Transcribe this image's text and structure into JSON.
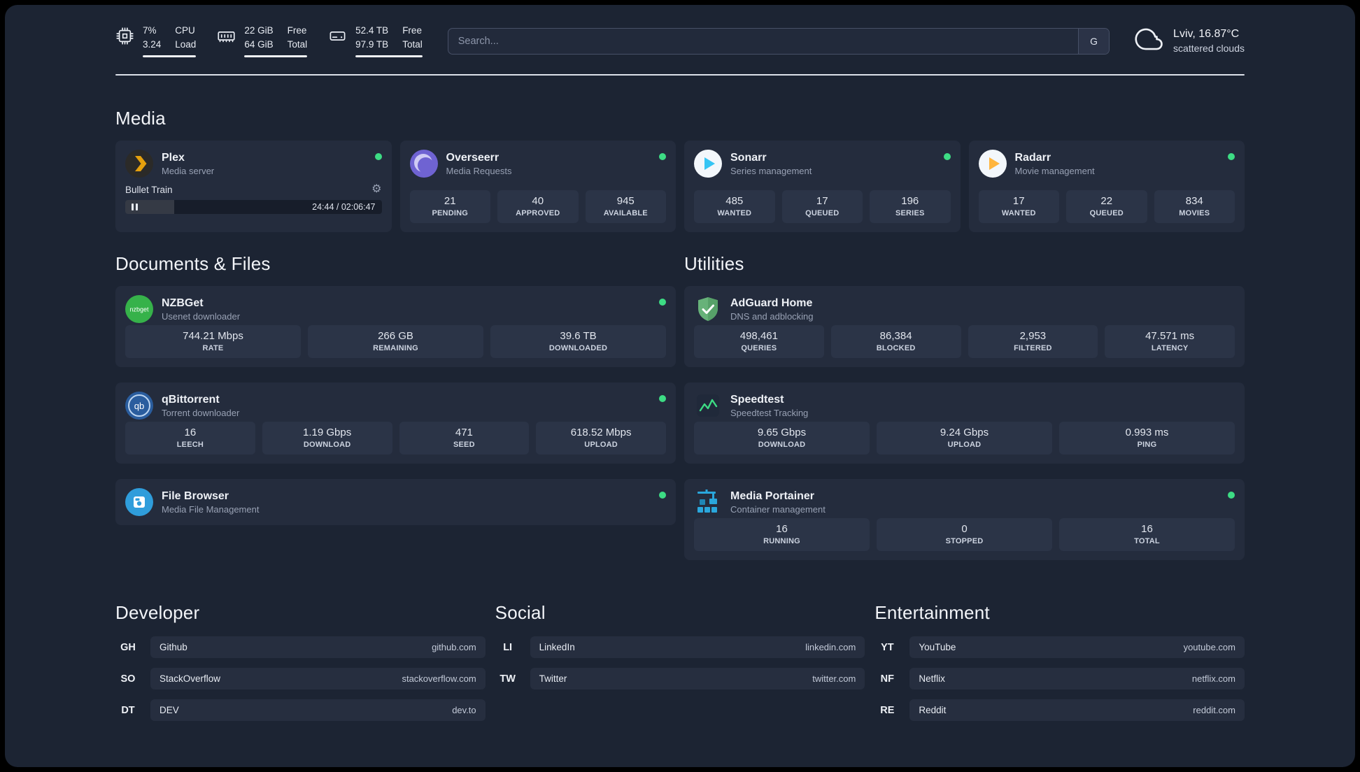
{
  "topbar": {
    "cpu": {
      "v1": "7%",
      "v2": "3.24",
      "l1": "CPU",
      "l2": "Load"
    },
    "ram": {
      "v1": "22 GiB",
      "v2": "64 GiB",
      "l1": "Free",
      "l2": "Total"
    },
    "disk": {
      "v1": "52.4 TB",
      "v2": "97.9 TB",
      "l1": "Free",
      "l2": "Total"
    },
    "search": {
      "placeholder": "Search...",
      "button": "G"
    },
    "weather": {
      "location": "Lviv, 16.87°C",
      "condition": "scattered clouds"
    }
  },
  "media": {
    "heading": "Media",
    "plex": {
      "name": "Plex",
      "desc": "Media server",
      "track": "Bullet Train",
      "time": "24:44 / 02:06:47"
    },
    "overseerr": {
      "name": "Overseerr",
      "desc": "Media Requests",
      "stats": [
        {
          "value": "21",
          "label": "PENDING"
        },
        {
          "value": "40",
          "label": "APPROVED"
        },
        {
          "value": "945",
          "label": "AVAILABLE"
        }
      ]
    },
    "sonarr": {
      "name": "Sonarr",
      "desc": "Series management",
      "stats": [
        {
          "value": "485",
          "label": "WANTED"
        },
        {
          "value": "17",
          "label": "QUEUED"
        },
        {
          "value": "196",
          "label": "SERIES"
        }
      ]
    },
    "radarr": {
      "name": "Radarr",
      "desc": "Movie management",
      "stats": [
        {
          "value": "17",
          "label": "WANTED"
        },
        {
          "value": "22",
          "label": "QUEUED"
        },
        {
          "value": "834",
          "label": "MOVIES"
        }
      ]
    }
  },
  "documents": {
    "heading": "Documents & Files",
    "nzbget": {
      "name": "NZBGet",
      "desc": "Usenet downloader",
      "icon_text": "nzbget",
      "stats": [
        {
          "value": "744.21 Mbps",
          "label": "RATE"
        },
        {
          "value": "266 GB",
          "label": "REMAINING"
        },
        {
          "value": "39.6 TB",
          "label": "DOWNLOADED"
        }
      ]
    },
    "qbittorrent": {
      "name": "qBittorrent",
      "desc": "Torrent downloader",
      "icon_text": "qb",
      "stats": [
        {
          "value": "16",
          "label": "LEECH"
        },
        {
          "value": "1.19 Gbps",
          "label": "DOWNLOAD"
        },
        {
          "value": "471",
          "label": "SEED"
        },
        {
          "value": "618.52 Mbps",
          "label": "UPLOAD"
        }
      ]
    },
    "filebrowser": {
      "name": "File Browser",
      "desc": "Media File Management"
    }
  },
  "utilities": {
    "heading": "Utilities",
    "adguard": {
      "name": "AdGuard Home",
      "desc": "DNS and adblocking",
      "stats": [
        {
          "value": "498,461",
          "label": "QUERIES"
        },
        {
          "value": "86,384",
          "label": "BLOCKED"
        },
        {
          "value": "2,953",
          "label": "FILTERED"
        },
        {
          "value": "47.571 ms",
          "label": "LATENCY"
        }
      ]
    },
    "speedtest": {
      "name": "Speedtest",
      "desc": "Speedtest Tracking",
      "stats": [
        {
          "value": "9.65 Gbps",
          "label": "DOWNLOAD"
        },
        {
          "value": "9.24 Gbps",
          "label": "UPLOAD"
        },
        {
          "value": "0.993 ms",
          "label": "PING"
        }
      ]
    },
    "portainer": {
      "name": "Media Portainer",
      "desc": "Container management",
      "stats": [
        {
          "value": "16",
          "label": "RUNNING"
        },
        {
          "value": "0",
          "label": "STOPPED"
        },
        {
          "value": "16",
          "label": "TOTAL"
        }
      ]
    }
  },
  "bookmarks": [
    {
      "heading": "Developer",
      "items": [
        {
          "abbr": "GH",
          "name": "Github",
          "url": "github.com"
        },
        {
          "abbr": "SO",
          "name": "StackOverflow",
          "url": "stackoverflow.com"
        },
        {
          "abbr": "DT",
          "name": "DEV",
          "url": "dev.to"
        }
      ]
    },
    {
      "heading": "Social",
      "items": [
        {
          "abbr": "LI",
          "name": "LinkedIn",
          "url": "linkedin.com"
        },
        {
          "abbr": "TW",
          "name": "Twitter",
          "url": "twitter.com"
        }
      ]
    },
    {
      "heading": "Entertainment",
      "items": [
        {
          "abbr": "YT",
          "name": "YouTube",
          "url": "youtube.com"
        },
        {
          "abbr": "NF",
          "name": "Netflix",
          "url": "netflix.com"
        },
        {
          "abbr": "RE",
          "name": "Reddit",
          "url": "reddit.com"
        }
      ]
    }
  ],
  "colors": {
    "status_online": "#3ddc84",
    "page_bg": "#1c2433",
    "card_bg": "#242c3d",
    "tile_bg": "#2b3447"
  }
}
